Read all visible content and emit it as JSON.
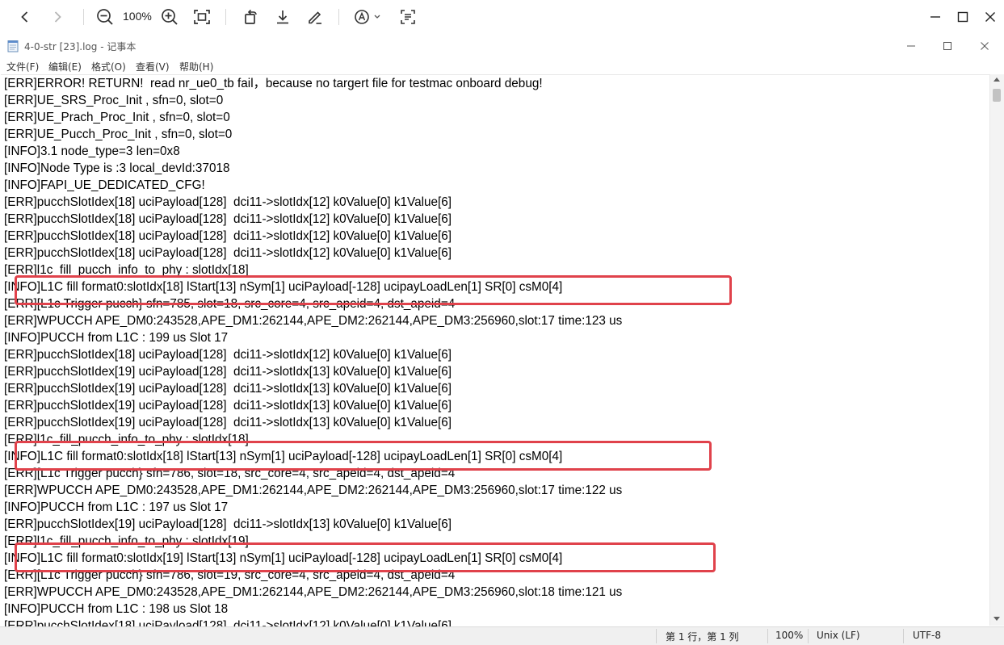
{
  "viewer": {
    "zoom": "100%",
    "icons": [
      "back-icon",
      "forward-icon",
      "zoom-out-icon",
      "zoom-in-icon",
      "fit-screen-icon",
      "rotate-icon",
      "download-icon",
      "edit-icon",
      "text-recognition-icon",
      "ocr-icon"
    ]
  },
  "notepad": {
    "title": "4-0-str [23].log - 记事本"
  },
  "menu": [
    "文件(F)",
    "编辑(E)",
    "格式(O)",
    "查看(V)",
    "帮助(H)"
  ],
  "log_lines": [
    "[ERR]ERROR! RETURN!  read nr_ue0_tb fail，because no targert file for testmac onboard debug!",
    "[ERR]UE_SRS_Proc_Init , sfn=0, slot=0",
    "[ERR]UE_Prach_Proc_Init , sfn=0, slot=0",
    "[ERR]UE_Pucch_Proc_Init , sfn=0, slot=0",
    "[INFO]3.1 node_type=3 len=0x8",
    "[INFO]Node Type is :3 local_devId:37018",
    "[INFO]FAPI_UE_DEDICATED_CFG!",
    "[ERR]pucchSlotIdex[18] uciPayload[128]  dci11->slotIdx[12] k0Value[0] k1Value[6]",
    "[ERR]pucchSlotIdex[18] uciPayload[128]  dci11->slotIdx[12] k0Value[0] k1Value[6]",
    "[ERR]pucchSlotIdex[18] uciPayload[128]  dci11->slotIdx[12] k0Value[0] k1Value[6]",
    "[ERR]pucchSlotIdex[18] uciPayload[128]  dci11->slotIdx[12] k0Value[0] k1Value[6]",
    "[ERR]l1c_fill_pucch_info_to_phy : slotIdx[18]",
    "[INFO]L1C fill format0:slotIdx[18] lStart[13] nSym[1] uciPayload[-128] ucipayLoadLen[1] SR[0] csM0[4]",
    "[ERR][L1c Trigger pucch} sfn=785, slot=18, src_core=4, src_apeid=4, dst_apeid=4",
    "[ERR]WPUCCH APE_DM0:243528,APE_DM1:262144,APE_DM2:262144,APE_DM3:256960,slot:17 time:123 us",
    "[INFO]PUCCH from L1C : 199 us Slot 17",
    "[ERR]pucchSlotIdex[18] uciPayload[128]  dci11->slotIdx[12] k0Value[0] k1Value[6]",
    "[ERR]pucchSlotIdex[19] uciPayload[128]  dci11->slotIdx[13] k0Value[0] k1Value[6]",
    "[ERR]pucchSlotIdex[19] uciPayload[128]  dci11->slotIdx[13] k0Value[0] k1Value[6]",
    "[ERR]pucchSlotIdex[19] uciPayload[128]  dci11->slotIdx[13] k0Value[0] k1Value[6]",
    "[ERR]pucchSlotIdex[19] uciPayload[128]  dci11->slotIdx[13] k0Value[0] k1Value[6]",
    "[ERR]l1c_fill_pucch_info_to_phy : slotIdx[18]",
    "[INFO]L1C fill format0:slotIdx[18] lStart[13] nSym[1] uciPayload[-128] ucipayLoadLen[1] SR[0] csM0[4]",
    "[ERR][L1c Trigger pucch} sfn=786, slot=18, src_core=4, src_apeid=4, dst_apeid=4",
    "[ERR]WPUCCH APE_DM0:243528,APE_DM1:262144,APE_DM2:262144,APE_DM3:256960,slot:17 time:122 us",
    "[INFO]PUCCH from L1C : 197 us Slot 17",
    "[ERR]pucchSlotIdex[19] uciPayload[128]  dci11->slotIdx[13] k0Value[0] k1Value[6]",
    "[ERR]l1c_fill_pucch_info_to_phy : slotIdx[19]",
    "[INFO]L1C fill format0:slotIdx[19] lStart[13] nSym[1] uciPayload[-128] ucipayLoadLen[1] SR[0] csM0[4]",
    "[ERR][L1c Trigger pucch} sfn=786, slot=19, src_core=4, src_apeid=4, dst_apeid=4",
    "[ERR]WPUCCH APE_DM0:243528,APE_DM1:262144,APE_DM2:262144,APE_DM3:256960,slot:18 time:121 us",
    "[INFO]PUCCH from L1C : 198 us Slot 18",
    "[ERR]pucchSlotIdex[18] uciPayload[128]  dci11->slotIdx[12] k0Value[0] k1Value[6]"
  ],
  "highlight_color": "#e0424b",
  "status": {
    "position": "第 1 行，第 1 列",
    "zoom": "100%",
    "line_ending": "Unix (LF)",
    "encoding": "UTF-8"
  }
}
